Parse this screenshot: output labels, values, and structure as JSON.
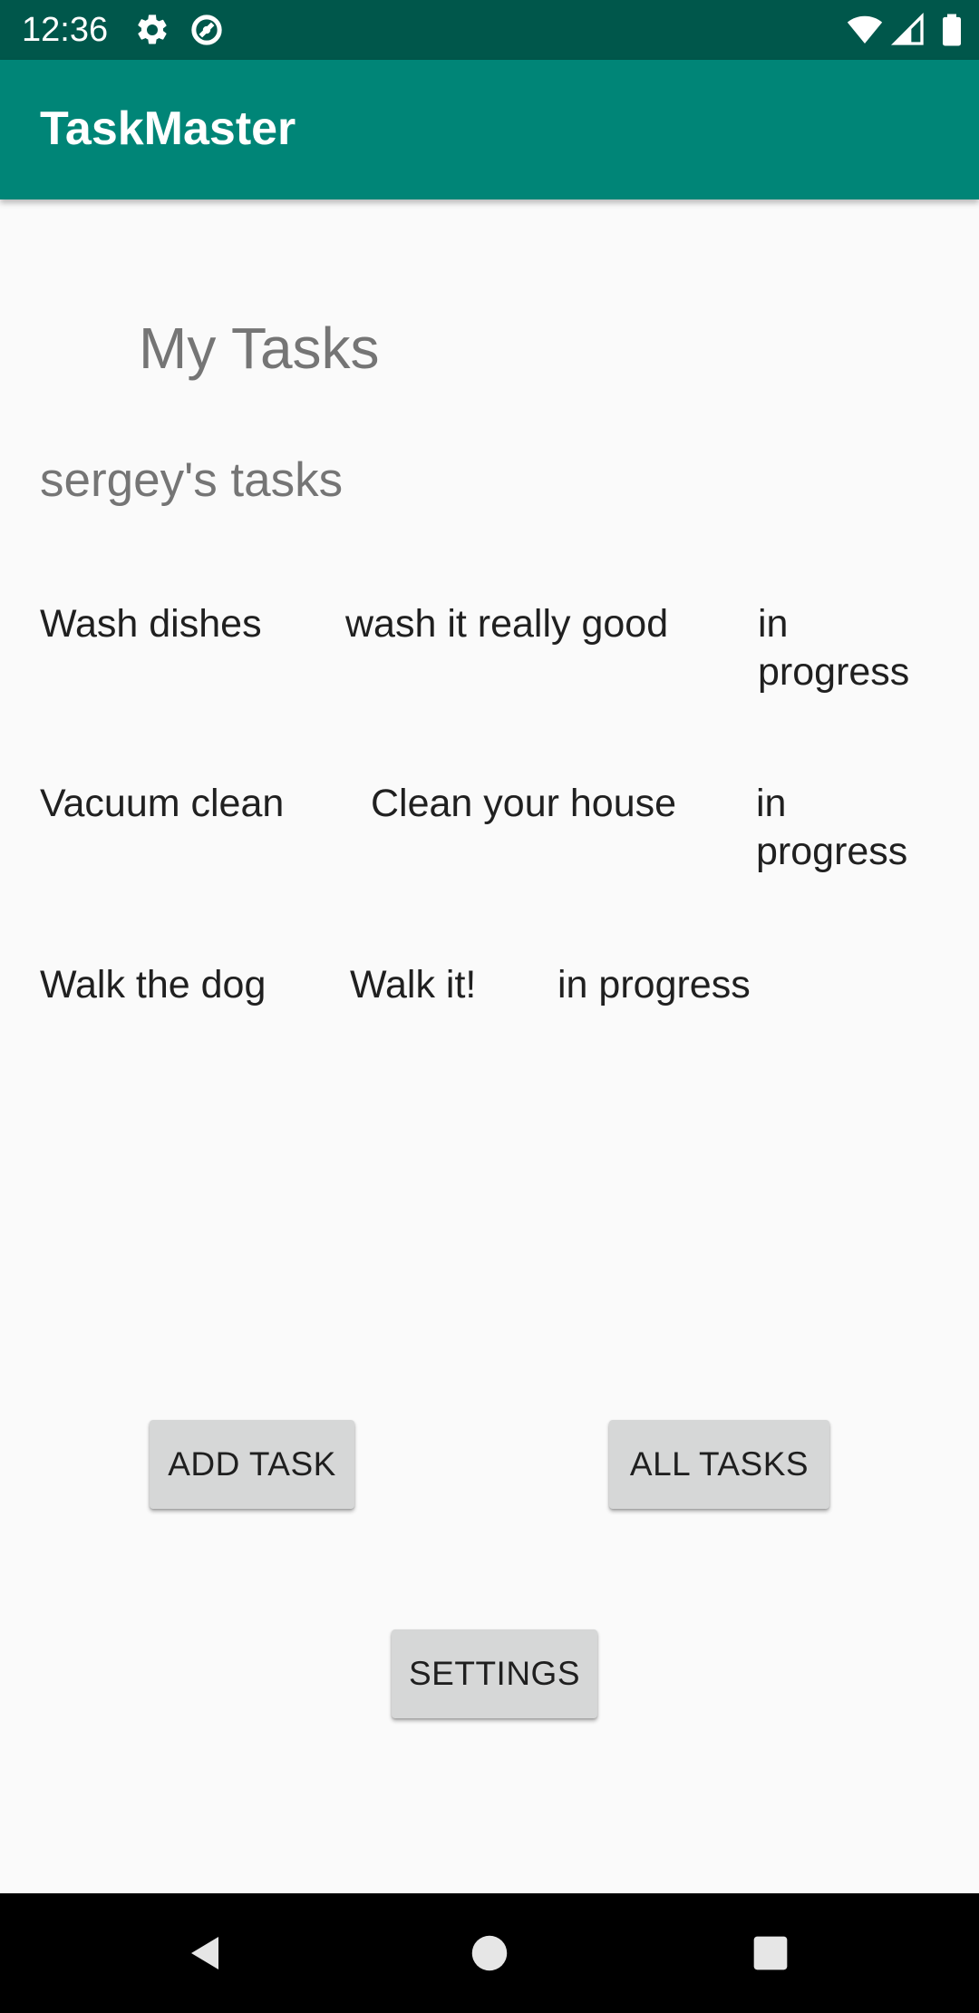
{
  "status_bar": {
    "time": "12:36",
    "left_icons": [
      "gear-icon",
      "data-saver-icon"
    ],
    "right_icons": [
      "wifi-icon",
      "signal-icon",
      "battery-icon"
    ]
  },
  "app_bar": {
    "title": "TaskMaster",
    "color": "#008577"
  },
  "main": {
    "heading": "My Tasks",
    "subheading": "sergey's tasks",
    "tasks": [
      {
        "title": "Wash dishes",
        "body": "wash it really good",
        "state": "in progress"
      },
      {
        "title": "Vacuum clean",
        "body": "Clean your house",
        "state": "in progress"
      },
      {
        "title": "Walk the dog",
        "body": "Walk it!",
        "state": "in progress"
      }
    ]
  },
  "buttons": {
    "add_task": "ADD TASK",
    "all_tasks": "ALL TASKS",
    "settings": "SETTINGS"
  },
  "nav_bar": {
    "icons": [
      "back-icon",
      "home-icon",
      "recents-icon"
    ]
  }
}
